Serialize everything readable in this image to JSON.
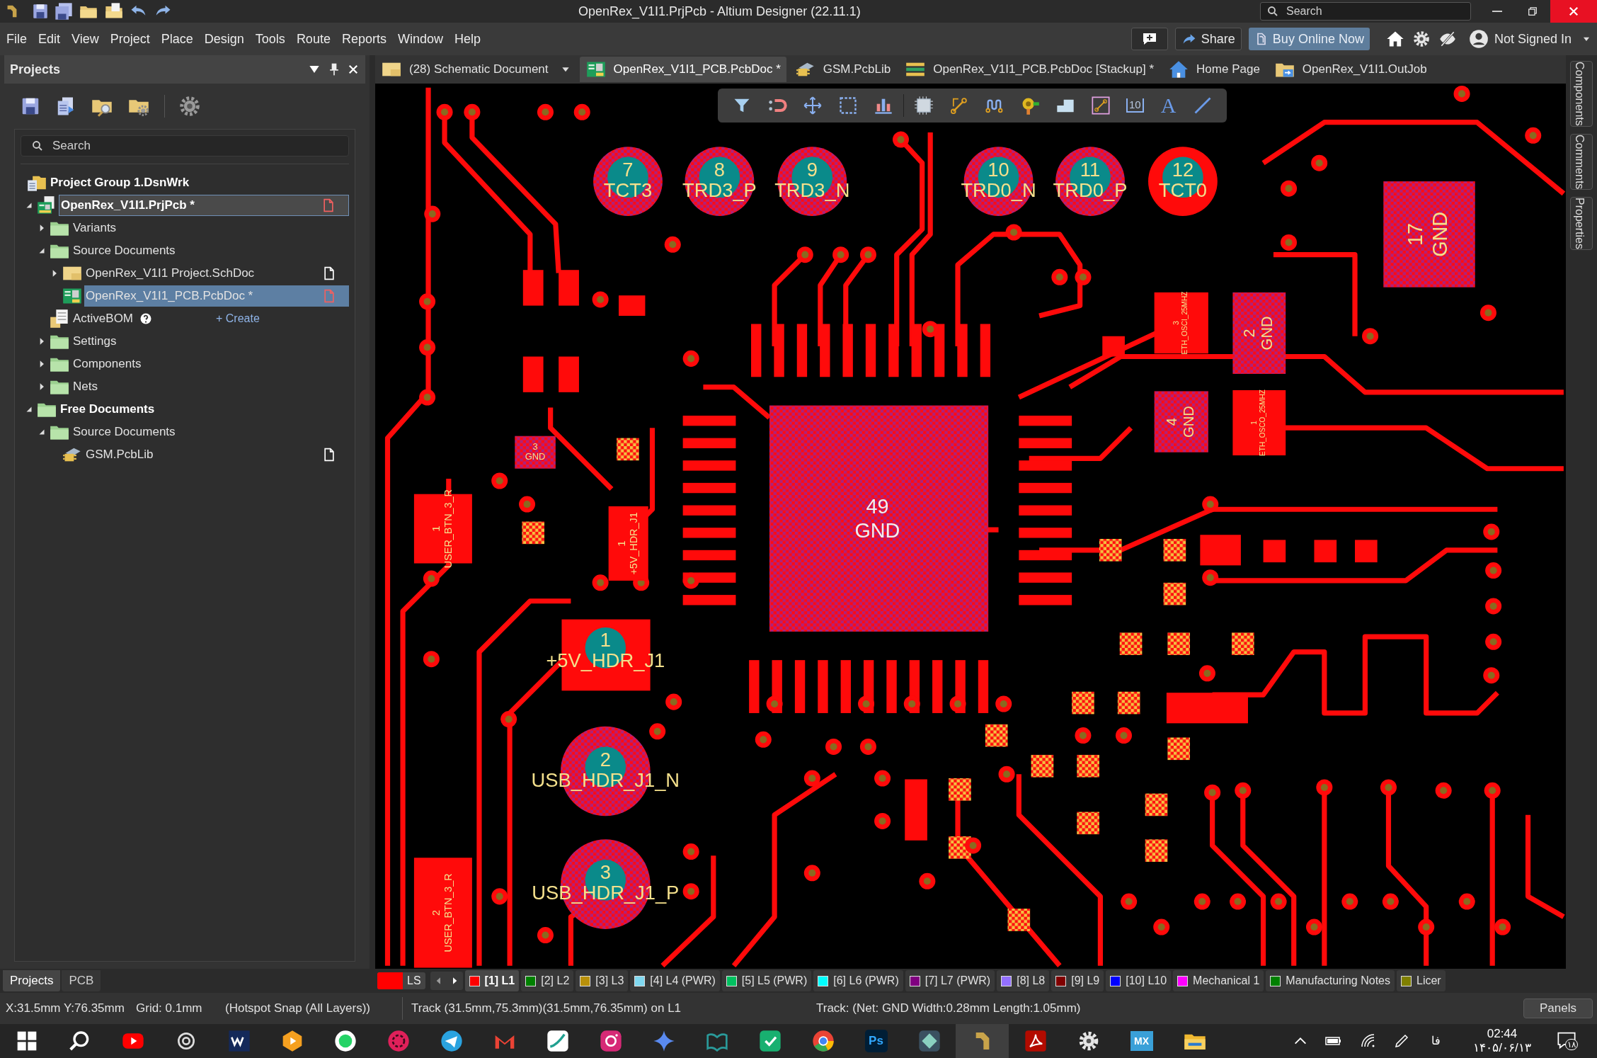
{
  "title_bar": {
    "title": "OpenRex_V1I1.PrjPcb - Altium Designer (22.11.1)",
    "search": {
      "placeholder": "Search"
    }
  },
  "menu": [
    "File",
    "Edit",
    "View",
    "Project",
    "Place",
    "Design",
    "Tools",
    "Route",
    "Reports",
    "Window",
    "Help"
  ],
  "header_buttons": {
    "share": "Share",
    "buy": "Buy Online Now",
    "account": "Not Signed In"
  },
  "document_tabs": [
    {
      "label": "(28) Schematic Document",
      "kind": "schematic",
      "selected": false
    },
    {
      "label": "OpenRex_V1I1_PCB.PcbDoc *",
      "kind": "pcb",
      "selected": true
    },
    {
      "label": "GSM.PcbLib",
      "kind": "pcblib",
      "selected": false
    },
    {
      "label": "OpenRex_V1I1_PCB.PcbDoc [Stackup] *",
      "kind": "stackup",
      "selected": false
    },
    {
      "label": "Home Page",
      "kind": "home",
      "selected": false
    },
    {
      "label": "OpenRex_V1I1.OutJob",
      "kind": "outjob",
      "selected": false
    }
  ],
  "projects_panel": {
    "title": "Projects",
    "search": {
      "placeholder": "Search"
    },
    "tree": [
      {
        "label": "Project Group 1.DsnWrk",
        "kind": "workspace",
        "selected": false,
        "active": false,
        "children": [
          {
            "label": "OpenRex_V1I1.PrjPcb *",
            "kind": "project",
            "expanded": true,
            "selected": false,
            "active": true,
            "modified": true,
            "children": [
              {
                "label": "Variants",
                "kind": "folder",
                "expanded": false,
                "selected": false,
                "active": false
              },
              {
                "label": "Source Documents",
                "kind": "folder",
                "expanded": true,
                "selected": false,
                "active": false,
                "children": [
                  {
                    "label": "OpenRex_V1I1 Project.SchDoc",
                    "kind": "schematic",
                    "expanded": false,
                    "selected": false,
                    "active": false,
                    "modified": false
                  },
                  {
                    "label": "OpenRex_V1I1_PCB.PcbDoc *",
                    "kind": "pcb",
                    "selected": true,
                    "active": false,
                    "modified": true
                  }
                ]
              },
              {
                "label": "ActiveBOM",
                "kind": "bom",
                "selected": false,
                "active": false,
                "action": "+ Create"
              },
              {
                "label": "Settings",
                "kind": "folder",
                "expanded": false,
                "selected": false,
                "active": false
              },
              {
                "label": "Components",
                "kind": "folder",
                "expanded": false,
                "selected": false,
                "active": false
              },
              {
                "label": "Nets",
                "kind": "folder",
                "expanded": false,
                "selected": false,
                "active": false
              }
            ]
          },
          {
            "label": "Free Documents",
            "kind": "group",
            "expanded": true,
            "selected": false,
            "active": false,
            "children": [
              {
                "label": "Source Documents",
                "kind": "folder",
                "expanded": true,
                "selected": false,
                "active": false,
                "children": [
                  {
                    "label": "GSM.PcbLib",
                    "kind": "pcblib",
                    "selected": false,
                    "active": false,
                    "modified": false
                  }
                ]
              }
            ]
          }
        ]
      }
    ]
  },
  "panel_tabs": [
    {
      "label": "Projects",
      "selected": true
    },
    {
      "label": "PCB",
      "selected": false
    }
  ],
  "side_panels": [
    "Components",
    "Comments",
    "Properties"
  ],
  "canvas_toolbar": [
    {
      "kind": "filter"
    },
    {
      "kind": "magnet"
    },
    {
      "kind": "move"
    },
    {
      "kind": "select"
    },
    {
      "kind": "align"
    },
    {
      "kind": "chip"
    },
    {
      "kind": "route"
    },
    {
      "kind": "wave"
    },
    {
      "kind": "via"
    },
    {
      "kind": "polygon"
    },
    {
      "kind": "trackbox"
    },
    {
      "kind": "dimension",
      "glyph": "10"
    },
    {
      "kind": "text",
      "glyph": "A"
    },
    {
      "kind": "line"
    }
  ],
  "pcb": {
    "round_pads": [
      {
        "number": "7",
        "net": "TCT3",
        "highlighted": true
      },
      {
        "number": "8",
        "net": "TRD3_P",
        "highlighted": true
      },
      {
        "number": "9",
        "net": "TRD3_N",
        "highlighted": true
      },
      {
        "number": "10",
        "net": "TRD0_N",
        "highlighted": true
      },
      {
        "number": "11",
        "net": "TRD0_P",
        "highlighted": true
      },
      {
        "number": "12",
        "net": "TCT0",
        "highlighted": false
      },
      {
        "number": "1",
        "net": "+5V_HDR_J1",
        "highlighted": false
      },
      {
        "number": "2",
        "net": "USB_HDR_J1_N",
        "highlighted": true
      },
      {
        "number": "3",
        "net": "USB_HDR_J1_P",
        "highlighted": true
      }
    ],
    "ic": {
      "number": "49",
      "net": "GND",
      "highlighted": true
    },
    "rect_pads": [
      {
        "number": "17",
        "net": "GND",
        "highlighted": true
      },
      {
        "number": "2",
        "net": "GND",
        "highlighted": true
      },
      {
        "number": "4",
        "net": "GND",
        "highlighted": true
      },
      {
        "number": "3",
        "net": "ETH_OSCI_25MHZ",
        "highlighted": false
      },
      {
        "number": "1",
        "net": "ETH_OSCO_25MHZ",
        "highlighted": false
      },
      {
        "number": "1",
        "net": "USER_BTN_3_R",
        "highlighted": false
      },
      {
        "number": "1",
        "net": "+5V_HDR_J1",
        "highlighted": false
      },
      {
        "number": "2",
        "net": "USER_BTN_3_R",
        "highlighted": false
      },
      {
        "number": "3",
        "net": "GND",
        "highlighted": true
      }
    ]
  },
  "layer_bar": {
    "ls": "LS",
    "layers": [
      {
        "label": "[1] L1",
        "color": "#ff0000",
        "selected": true
      },
      {
        "label": "[2] L2",
        "color": "#008000",
        "selected": false
      },
      {
        "label": "[3] L3",
        "color": "#b8900a",
        "selected": false
      },
      {
        "label": "[4] L4 (PWR)",
        "color": "#80d8f0",
        "selected": false
      },
      {
        "label": "[5] L5 (PWR)",
        "color": "#00c060",
        "selected": false
      },
      {
        "label": "[6] L6 (PWR)",
        "color": "#00ffff",
        "selected": false
      },
      {
        "label": "[7] L7 (PWR)",
        "color": "#800080",
        "selected": false
      },
      {
        "label": "[8] L8",
        "color": "#9370ff",
        "selected": false
      },
      {
        "label": "[9] L9",
        "color": "#800000",
        "selected": false
      },
      {
        "label": "[10] L10",
        "color": "#0000ff",
        "selected": false
      },
      {
        "label": "Mechanical 1",
        "color": "#ff00ff",
        "selected": false
      },
      {
        "label": "Manufacturing Notes",
        "color": "#008000",
        "selected": false
      },
      {
        "label": "Licer",
        "color": "#808000",
        "selected": false
      }
    ]
  },
  "status_bar": {
    "coords": "X:31.5mm Y:76.35mm",
    "grid": "Grid: 0.1mm",
    "snap": "(Hotspot Snap (All Layers))",
    "track": "Track (31.5mm,75.3mm)(31.5mm,76.35mm) on L1",
    "net": "Track: (Net: GND Width:0.28mm Length:1.05mm)",
    "panels": "Panels"
  },
  "taskbar": {
    "apps": [
      {
        "kind": "start",
        "selected": false
      },
      {
        "kind": "search",
        "selected": false
      },
      {
        "kind": "video",
        "selected": false
      },
      {
        "kind": "knot",
        "selected": false
      },
      {
        "kind": "wlogo",
        "selected": false
      },
      {
        "kind": "player",
        "selected": false
      },
      {
        "kind": "chat",
        "selected": false
      },
      {
        "kind": "flower",
        "selected": false
      },
      {
        "kind": "plane",
        "selected": false
      },
      {
        "kind": "mail",
        "selected": false
      },
      {
        "kind": "sketch",
        "selected": false
      },
      {
        "kind": "camera",
        "selected": false
      },
      {
        "kind": "sparkle",
        "selected": false
      },
      {
        "kind": "book",
        "selected": false
      },
      {
        "kind": "shield",
        "selected": false
      },
      {
        "kind": "browser",
        "selected": false
      },
      {
        "kind": "badge",
        "label": "Ps",
        "selected": false
      },
      {
        "kind": "diamond",
        "selected": false
      },
      {
        "kind": "altium",
        "selected": true
      },
      {
        "kind": "pdf",
        "selected": false
      },
      {
        "kind": "gear",
        "selected": false
      },
      {
        "kind": "badge2",
        "label": "MX",
        "selected": false
      },
      {
        "kind": "folder",
        "selected": false
      }
    ],
    "language": "فا",
    "time": "02:44",
    "date": "۱۴۰۵/۰۶/۱۳",
    "notifications": "۱۸"
  }
}
